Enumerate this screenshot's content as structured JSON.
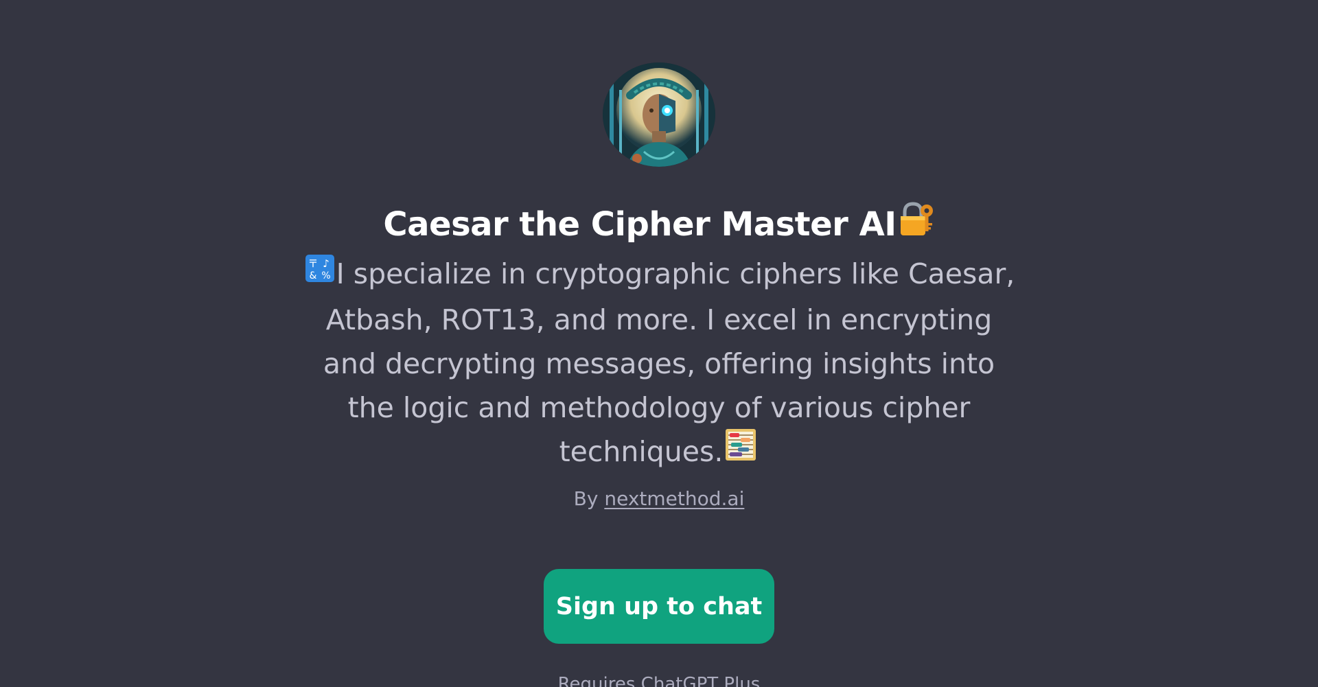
{
  "gpt": {
    "title": "Caesar the Cipher Master AI",
    "title_emoji": "locked-with-key-icon",
    "description": "I specialize in cryptographic ciphers like Caesar, Atbash, ROT13, and more. I excel in encrypting and decrypting messages, offering insights into the logic and methodology of various cipher techniques.",
    "description_lead_emoji": "input-symbols-icon",
    "description_trail_emoji": "abacus-icon",
    "byline_prefix": "By",
    "author": "nextmethod.ai"
  },
  "actions": {
    "signup_label": "Sign up to chat"
  },
  "footer": {
    "note": "Requires ChatGPT Plus"
  },
  "colors": {
    "background": "#343541",
    "accent": "#10a37f",
    "title": "#ffffff",
    "body_text": "#c5c5d2",
    "muted_text": "#acacbe"
  }
}
